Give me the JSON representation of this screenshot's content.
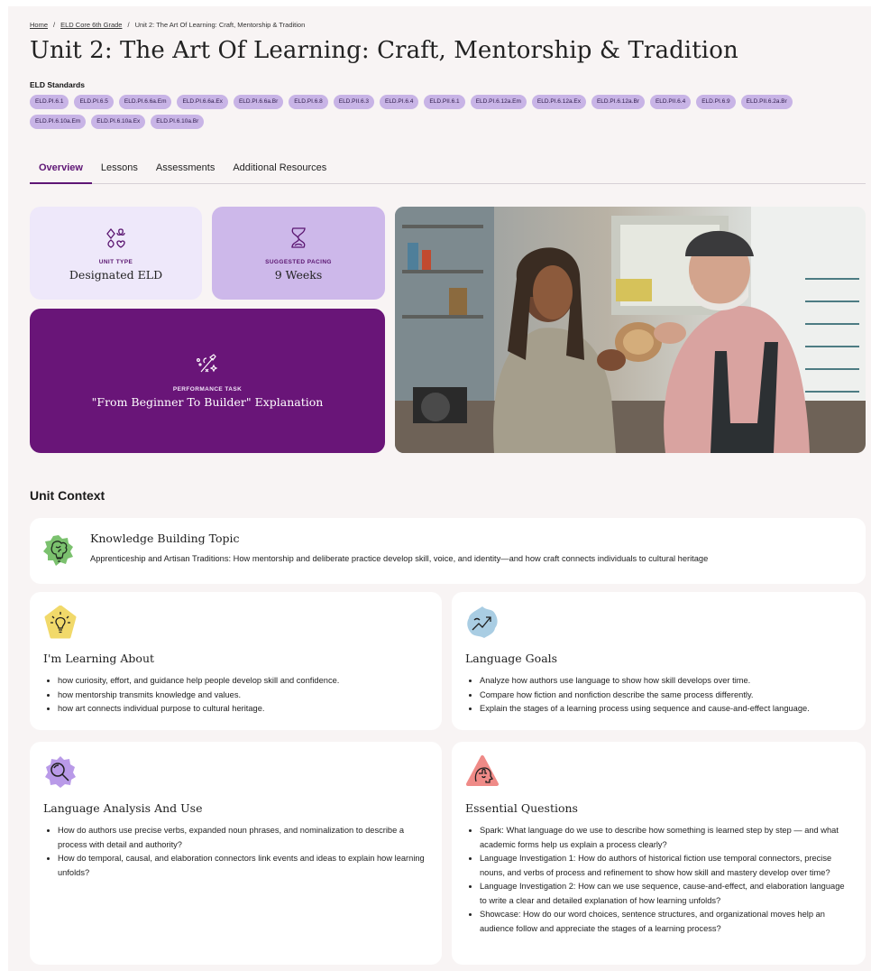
{
  "breadcrumb": {
    "home": "Home",
    "sep1": "/",
    "course": "ELD Core 6th Grade",
    "sep2": "/",
    "current": "Unit 2: The Art Of Learning: Craft, Mentorship & Tradition"
  },
  "page_title": "Unit 2: The Art Of Learning: Craft, Mentorship & Tradition",
  "standards": {
    "label": "ELD Standards",
    "chips": [
      "ELD.PI.6.1",
      "ELD.PI.6.5",
      "ELD.PI.6.6a.Em",
      "ELD.PI.6.6a.Ex",
      "ELD.PI.6.6a.Br",
      "ELD.PI.6.8",
      "ELD.PII.6.3",
      "ELD.PI.6.4",
      "ELD.PII.6.1",
      "ELD.PI.6.12a.Em",
      "ELD.PI.6.12a.Ex",
      "ELD.PI.6.12a.Br",
      "ELD.PII.6.4",
      "ELD.PI.6.9",
      "ELD.PII.6.2a.Br",
      "ELD.PI.6.10a.Em",
      "ELD.PI.6.10a.Ex",
      "ELD.PI.6.10a.Br"
    ]
  },
  "tabs": [
    {
      "label": "Overview",
      "active": true
    },
    {
      "label": "Lessons",
      "active": false
    },
    {
      "label": "Assessments",
      "active": false
    },
    {
      "label": "Additional Resources",
      "active": false
    }
  ],
  "unit_type": {
    "label": "UNIT TYPE",
    "value": "Designated ELD",
    "icon": "suit-shapes-icon"
  },
  "pacing": {
    "label": "SUGGESTED PACING",
    "value": "9 Weeks",
    "icon": "hourglass-icon"
  },
  "performance_task": {
    "label": "PERFORMANCE TASK",
    "value": "\"From Beginner To Builder\" Explanation",
    "icon": "sparkle-tools-icon"
  },
  "photo": {
    "icon": "mentor-woodworking-photo"
  },
  "unit_context": {
    "heading": "Unit Context",
    "knowledge": {
      "title": "Knowledge Building Topic",
      "text": "Apprenticeship and Artisan Traditions: How mentorship and deliberate practice develop skill, voice, and identity—and how craft connects individuals to cultural heritage",
      "icon": "brain-lightbulb-icon"
    },
    "learning": {
      "title": "I'm Learning About",
      "icon": "lightbulb-icon",
      "items": [
        "how curiosity, effort, and guidance help people develop skill and confidence.",
        "how mentorship transmits knowledge and values.",
        "how art connects individual purpose to cultural heritage."
      ]
    },
    "language_goals": {
      "title": "Language Goals",
      "icon": "trend-arrow-icon",
      "items": [
        "Analyze how authors use language to show how skill develops over time.",
        "Compare how fiction and nonfiction describe the same process differently.",
        "Explain the stages of a learning process using sequence and cause-and-effect language."
      ]
    },
    "analysis": {
      "title": "Language Analysis And Use",
      "icon": "magnifier-icon",
      "items": [
        "How do authors use precise verbs, expanded noun phrases, and nominalization to describe a process with detail and authority?",
        "How do temporal, causal, and elaboration connectors link events and ideas to explain how learning unfolds?"
      ]
    },
    "questions": {
      "title": "Essential Questions",
      "icon": "puzzle-head-icon",
      "items": [
        "Spark: What language do we use to describe how something is learned step by step — and what academic forms help us explain a process clearly?",
        "Language Investigation 1: How do authors of historical fiction use temporal connectors, precise nouns, and verbs of process and refinement to show how skill and mastery develop over time?",
        "Language Investigation 2: How can we use sequence, cause-and-effect, and elaboration language to write a clear and detailed explanation of how learning unfolds?",
        "Showcase: How do our word choices, sentence structures, and organizational moves help an audience follow and appreciate the stages of a learning process?"
      ]
    }
  }
}
